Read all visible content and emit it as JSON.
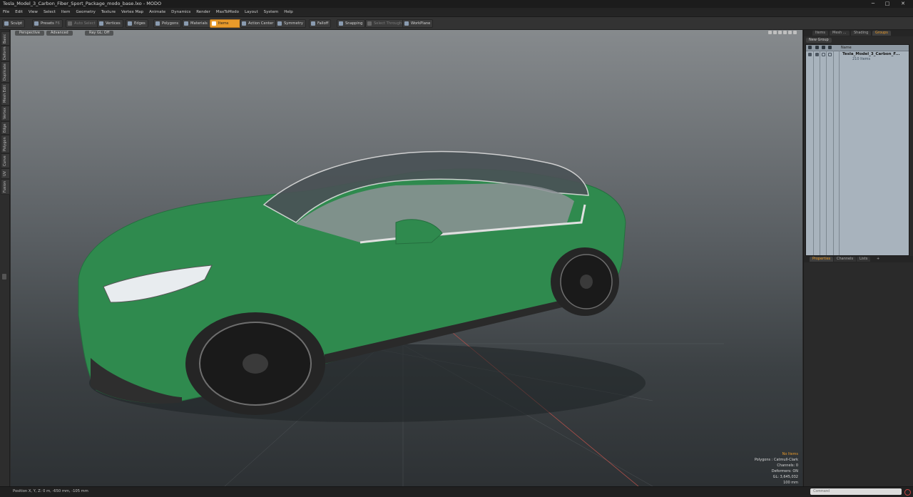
{
  "window": {
    "title": "Tesla_Model_3_Carbon_Fiber_Sport_Package_modo_base.lxo - MODO",
    "minimize_glyph": "─",
    "maximize_glyph": "□",
    "close_glyph": "✕"
  },
  "menu": [
    "File",
    "Edit",
    "View",
    "Select",
    "Item",
    "Geometry",
    "Texture",
    "Vertex Map",
    "Animate",
    "Dynamics",
    "Render",
    "MaxToModo",
    "Layout",
    "System",
    "Help"
  ],
  "toolbar": {
    "sculpt": "Sculpt",
    "presets": "Presets",
    "presets_key": "F6",
    "auto_select": "Auto Select",
    "vertices": "Vertices",
    "edges": "Edges",
    "polygons": "Polygons",
    "materials": "Materials",
    "items": "Items",
    "action_center": "Action Center",
    "symmetry": "Symmetry",
    "falloff": "Falloff",
    "snapping": "Snapping",
    "select_through": "Select Through",
    "workplane": "WorkPlane"
  },
  "left_tabs": [
    "Basic",
    "Deform",
    "Duplicate",
    "Mesh Edit",
    "Vertex",
    "Edge",
    "Polygon",
    "Curve",
    "UV",
    "Fusion"
  ],
  "viewport": {
    "view_mode": "Perspective",
    "shading": "Advanced",
    "ray_gl": "Ray GL: Off",
    "info": {
      "selection": "No Items",
      "polygons": "Polygons : Catmull-Clark",
      "channels": "Channels: 0",
      "deformers": "Deformers: ON",
      "gl": "GL: 3,645,032",
      "scale": "100 mm"
    }
  },
  "right_panel": {
    "top_tabs": [
      "Items",
      "Mesh ...",
      "Shading",
      "Groups"
    ],
    "new_group": "New Group",
    "name_col": "Name",
    "group_name": "Tesla_Model_3_Carbon_F...",
    "group_count": "210 Items",
    "bottom_tabs": [
      "Properties",
      "Channels",
      "Lists"
    ],
    "add_tab_glyph": "+"
  },
  "status": {
    "position": "Position X, Y, Z:   0 m,  -650 mm,  -105 mm",
    "command_placeholder": "Command"
  },
  "colors": {
    "accent": "#e89a2a",
    "car_body": "#2f8a4e"
  }
}
